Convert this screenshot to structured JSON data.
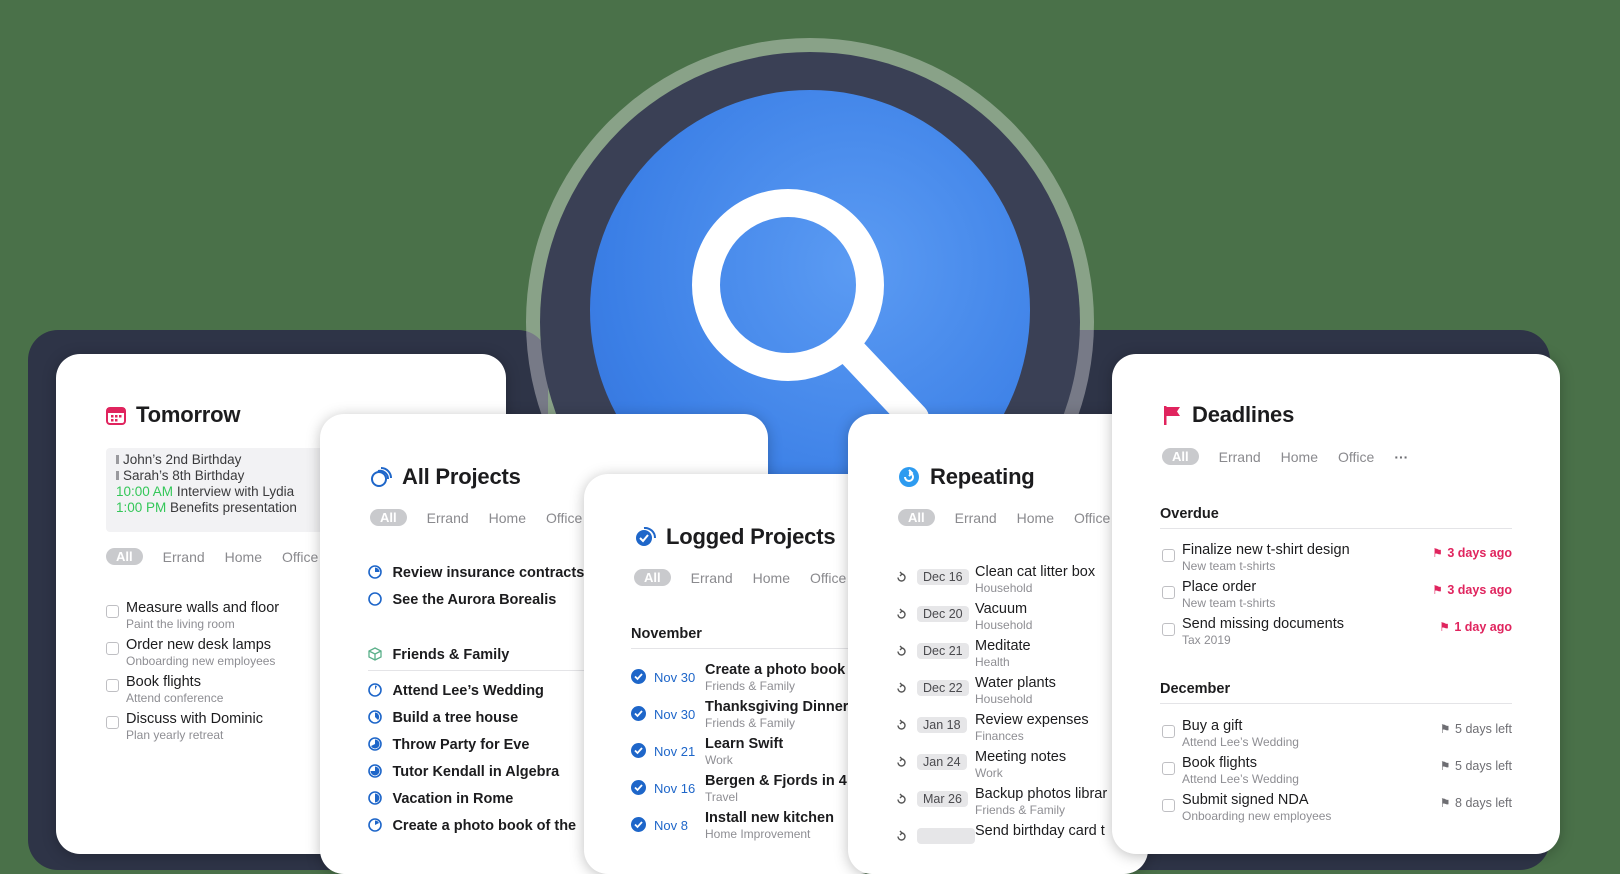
{
  "colors": {
    "accent": "#3b7fe6",
    "deadline_red": "#e0245e",
    "today_green": "#34c759"
  },
  "tomorrow": {
    "title": "Tomorrow",
    "icon": "calendar-icon",
    "events": [
      {
        "time": "",
        "text": "John’s 2nd Birthday"
      },
      {
        "time": "",
        "text": "Sarah’s 8th Birthday"
      },
      {
        "time": "10:00 AM",
        "text": "Interview with Lydia"
      },
      {
        "time": "1:00 PM",
        "text": "Benefits presentation"
      }
    ],
    "tags": [
      "All",
      "Errand",
      "Home",
      "Office"
    ],
    "tasks": [
      {
        "title": "Measure walls and floor",
        "sub": "Paint the living room"
      },
      {
        "title": "Order new desk lamps",
        "sub": "Onboarding new employees"
      },
      {
        "title": "Book flights",
        "sub": "Attend conference"
      },
      {
        "title": "Discuss with Dominic",
        "sub": "Plan yearly retreat"
      }
    ]
  },
  "all_projects": {
    "title": "All Projects",
    "icon": "projects-icon",
    "tags": [
      "All",
      "Errand",
      "Home",
      "Office"
    ],
    "top_items": [
      "Review insurance contracts",
      "See the Aurora Borealis"
    ],
    "area": "Friends & Family",
    "area_items": [
      "Attend Lee’s Wedding",
      "Build a tree house",
      "Throw Party for Eve",
      "Tutor Kendall in Algebra",
      "Vacation in Rome",
      "Create a photo book of the"
    ]
  },
  "logged": {
    "title": "Logged Projects",
    "icon": "logged-check-icon",
    "tags": [
      "All",
      "Errand",
      "Home",
      "Office"
    ],
    "month": "November",
    "items": [
      {
        "date": "Nov 30",
        "title": "Create a photo book",
        "sub": "Friends & Family"
      },
      {
        "date": "Nov 30",
        "title": "Thanksgiving Dinner",
        "sub": "Friends & Family"
      },
      {
        "date": "Nov 21",
        "title": "Learn Swift",
        "sub": "Work"
      },
      {
        "date": "Nov 16",
        "title": "Bergen & Fjords in 4",
        "sub": "Travel"
      },
      {
        "date": "Nov 8",
        "title": "Install new kitchen",
        "sub": "Home Improvement"
      }
    ]
  },
  "repeating": {
    "title": "Repeating",
    "icon": "repeat-icon",
    "tags": [
      "All",
      "Errand",
      "Home",
      "Office"
    ],
    "items": [
      {
        "date": "Dec 16",
        "title": "Clean cat litter box",
        "sub": "Household"
      },
      {
        "date": "Dec 20",
        "title": "Vacuum",
        "sub": "Household"
      },
      {
        "date": "Dec 21",
        "title": "Meditate",
        "sub": "Health"
      },
      {
        "date": "Dec 22",
        "title": "Water plants",
        "sub": "Household"
      },
      {
        "date": "Jan 18",
        "title": "Review expenses",
        "sub": "Finances"
      },
      {
        "date": "Jan 24",
        "title": "Meeting notes",
        "sub": "Work"
      },
      {
        "date": "Mar 26",
        "title": "Backup photos librar",
        "sub": "Friends & Family"
      },
      {
        "date": "",
        "title": "Send birthday card t",
        "sub": ""
      }
    ]
  },
  "deadlines": {
    "title": "Deadlines",
    "icon": "flag-icon",
    "tags": [
      "All",
      "Errand",
      "Home",
      "Office",
      "···"
    ],
    "overdue_head": "Overdue",
    "overdue": [
      {
        "title": "Finalize new t-shirt design",
        "sub": "New team t-shirts",
        "due": "3 days ago"
      },
      {
        "title": "Place order",
        "sub": "New team t-shirts",
        "due": "3 days ago"
      },
      {
        "title": "Send missing documents",
        "sub": "Tax 2019",
        "due": "1 day ago"
      }
    ],
    "december_head": "December",
    "december": [
      {
        "title": "Buy a gift",
        "sub": "Attend Lee’s Wedding",
        "due": "5 days left"
      },
      {
        "title": "Book flights",
        "sub": "Attend Lee’s Wedding",
        "due": "5 days left"
      },
      {
        "title": "Submit signed NDA",
        "sub": "Onboarding new employees",
        "due": "8 days left"
      }
    ]
  }
}
